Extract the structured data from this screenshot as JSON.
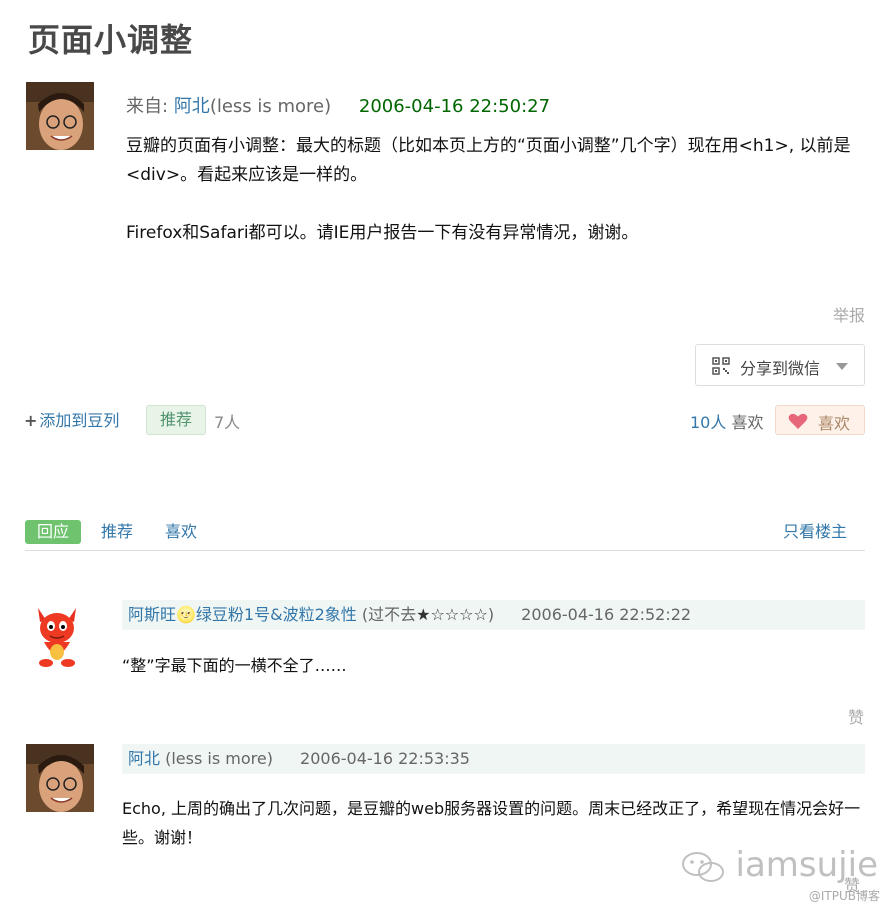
{
  "page": {
    "title": "页面小调整"
  },
  "post": {
    "from_label": "来自:",
    "author_name": "阿北",
    "author_note": "(less is more)",
    "time": "2006-04-16 22:50:27",
    "body": [
      "豆瓣的页面有小调整：最大的标题（比如本页上方的“页面小调整”几个字）现在用<h1>, 以前是<div>。看起来应该是一样的。",
      "Firefox和Safari都可以。请IE用户报告一下有没有异常情况，谢谢。"
    ],
    "report_label": "举报",
    "share_label": "分享到微信",
    "add_doulist_label": "添加到豆列",
    "recommend_label": "推荐",
    "recommend_count": "7人",
    "like_count_num": "10人",
    "like_count_label": "喜欢",
    "like_label": "喜欢"
  },
  "tabs": [
    {
      "label": "回应"
    },
    {
      "label": "推荐"
    },
    {
      "label": "喜欢"
    },
    {
      "label": "只看楼主"
    }
  ],
  "comments": [
    {
      "author": "阿斯旺🌝绿豆粉1号&波粒2象性",
      "note_open": "(过不去",
      "rating": "★☆☆☆☆",
      "note_close": ")",
      "time": "2006-04-16 22:52:22",
      "body": "“整”字最下面的一横不全了……",
      "zan_label": "赞"
    },
    {
      "author": "阿北",
      "note": "(less is more)",
      "time": "2006-04-16 22:53:35",
      "body": "Echo, 上周的确出了几次问题，是豆瓣的web服务器设置的问题。周末已经改正了，希望现在情况会好一些。谢谢！",
      "zan_label": "赞"
    }
  ],
  "watermark": {
    "text": "iamsujie",
    "source": "@ITPUB博客"
  },
  "colors": {
    "link": "#3377aa",
    "time_green": "#006600",
    "tab_active": "#6fc36f",
    "comment_head_bg": "#f0f6f3"
  }
}
